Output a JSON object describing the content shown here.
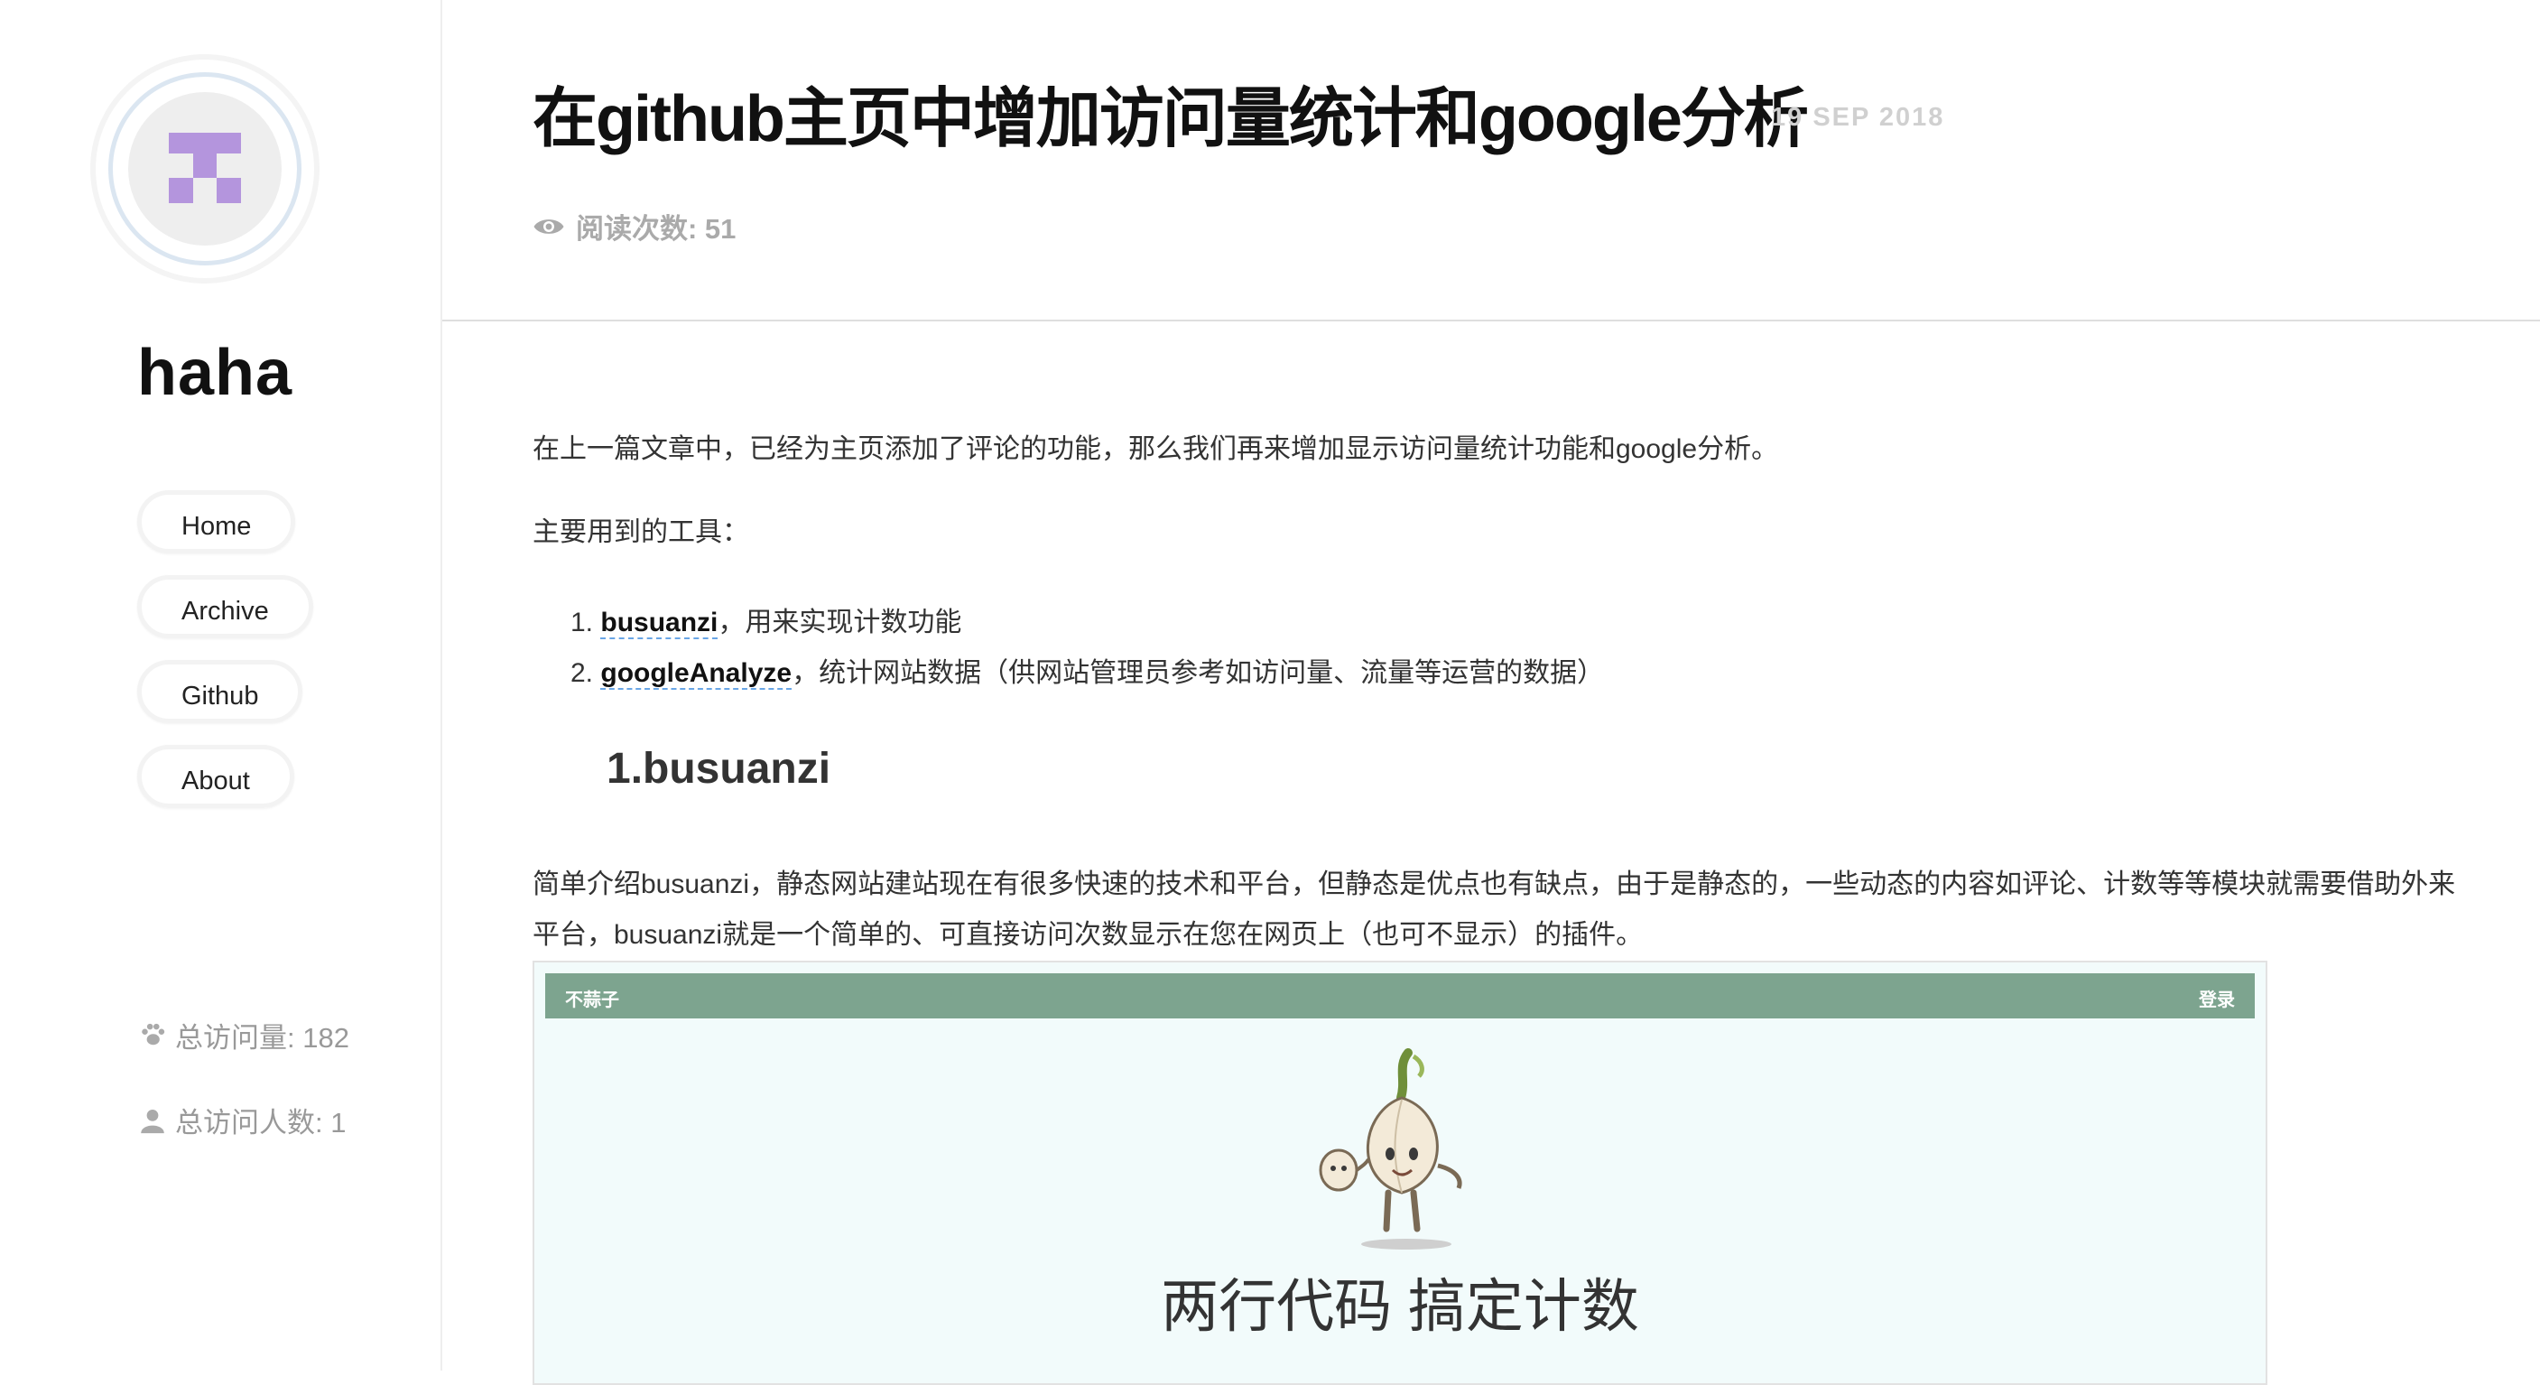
{
  "sidebar": {
    "site_name": "haha",
    "nav": [
      {
        "label": "Home"
      },
      {
        "label": "Archive"
      },
      {
        "label": "Github"
      },
      {
        "label": "About"
      }
    ],
    "stats": {
      "total_views": "总访问量: 182",
      "total_visitors": "总访问人数: 1"
    }
  },
  "post": {
    "title": "在github主页中增加访问量统计和google分析",
    "date": "19 SEP 2018",
    "views": "阅读次数: 51",
    "intro": "在上一篇文章中，已经为主页添加了评论的功能，那么我们再来增加显示访问量统计功能和google分析。",
    "tools_label": "主要用到的工具：",
    "tools": [
      {
        "num": "1.",
        "name": "busuanzi",
        "desc": "，用来实现计数功能"
      },
      {
        "num": "2.",
        "name": "googleAnalyze",
        "desc": "，统计网站数据（供网站管理员参考如访问量、流量等运营的数据）"
      }
    ],
    "section_heading": "1.busuanzi",
    "section_body": "简单介绍busuanzi，静态网站建站现在有很多快速的技术和平台，但静态是优点也有缺点，由于是静态的，一些动态的内容如评论、计数等等模块就需要借助外来平台，busuanzi就是一个简单的、可直接访问次数显示在您在网页上（也可不显示）的插件。"
  },
  "embedded_screenshot": {
    "brand": "不蒜子",
    "login": "登录",
    "slogan": "两行代码 搞定计数"
  },
  "colors": {
    "avatar_pixel": "#b495dd",
    "link_underline": "#6aa6e6",
    "embedded_bar": "#7da48f"
  }
}
